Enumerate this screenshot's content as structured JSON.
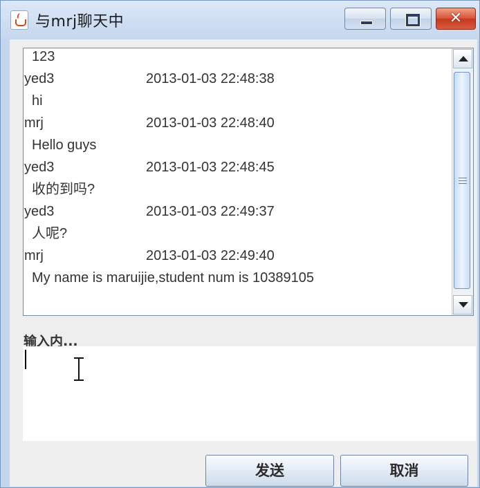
{
  "window": {
    "title": "与mrj聊天中",
    "close_glyph": "✕"
  },
  "chat": {
    "lines": [
      {
        "type": "msg",
        "text": "123"
      },
      {
        "type": "meta",
        "user": "yed3",
        "time": "2013-01-03 22:48:38"
      },
      {
        "type": "msg",
        "text": "hi"
      },
      {
        "type": "meta",
        "user": "mrj",
        "time": "2013-01-03 22:48:40"
      },
      {
        "type": "msg",
        "text": "Hello guys"
      },
      {
        "type": "meta",
        "user": "yed3",
        "time": "2013-01-03 22:48:45"
      },
      {
        "type": "msg",
        "text": "收的到吗?"
      },
      {
        "type": "meta",
        "user": "yed3",
        "time": "2013-01-03 22:49:37"
      },
      {
        "type": "msg",
        "text": "人呢?"
      },
      {
        "type": "meta",
        "user": "mrj",
        "time": "2013-01-03 22:49:40"
      },
      {
        "type": "msg",
        "text": "My name is maruijie,student num is 10389105"
      }
    ]
  },
  "input": {
    "label": "输入内...",
    "value": ""
  },
  "buttons": {
    "send_label": "发送",
    "cancel_label": "取消"
  },
  "colors": {
    "titlebar": "#c3d6ee",
    "close_button": "#c33a20",
    "client_bg": "#eeeeee",
    "scroll_thumb": "#c7dcf5"
  },
  "icons": {
    "app": "java-cup-icon",
    "minimize": "minimize-icon",
    "maximize": "maximize-icon",
    "close": "close-icon"
  }
}
